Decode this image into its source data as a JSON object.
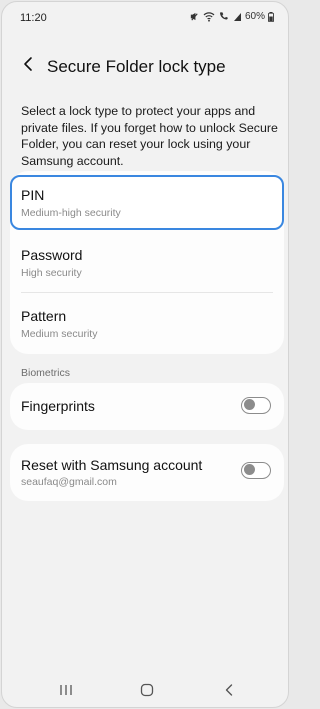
{
  "status_bar": {
    "time": "11:20",
    "battery": "60%",
    "icons": [
      "mute-icon",
      "wifi-icon",
      "wifi-calling-icon",
      "signal-icon",
      "battery-icon"
    ]
  },
  "header": {
    "title": "Secure Folder lock type",
    "back_icon": "back-arrow-icon"
  },
  "description": "Select a lock type to protect your apps and private files. If you forget how to unlock Secure Folder, you can reset your lock using your Samsung account.",
  "lock_options": [
    {
      "title": "PIN",
      "subtitle": "Medium-high security",
      "selected": true
    },
    {
      "title": "Password",
      "subtitle": "High security",
      "selected": false
    },
    {
      "title": "Pattern",
      "subtitle": "Medium security",
      "selected": false
    }
  ],
  "biometrics": {
    "section_label": "Biometrics",
    "fingerprints": {
      "title": "Fingerprints",
      "enabled": false
    }
  },
  "reset": {
    "title": "Reset with Samsung account",
    "account": "seaufaq@gmail.com",
    "enabled": false
  },
  "nav_bar": {
    "icons": [
      "recent-apps-icon",
      "home-icon",
      "back-icon"
    ]
  },
  "colors": {
    "background": "#f2f2f2",
    "card": "#fdfdfd",
    "highlight": "#3a87e0",
    "toggle_off": "#8c8c8c"
  }
}
